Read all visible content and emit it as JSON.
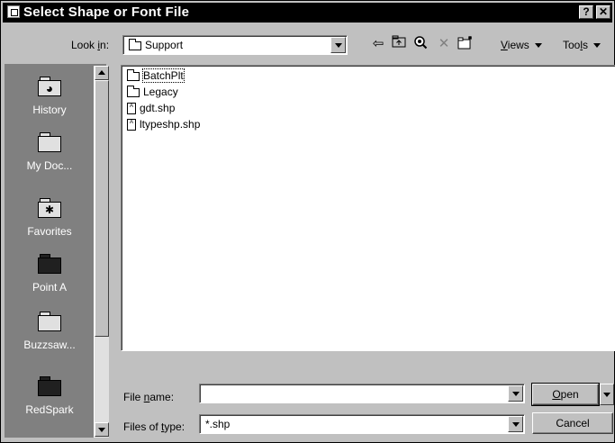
{
  "window": {
    "title": "Select Shape or Font File",
    "help_label": "?",
    "close_label": "✕"
  },
  "lookin": {
    "label": "Look in:",
    "label_hotkey": "i",
    "value": "Support"
  },
  "toolbar": {
    "back_icon": "back-arrow-icon",
    "up_icon": "up-folder-icon",
    "search_icon": "search-web-icon",
    "delete_icon": "delete-icon",
    "new_folder_icon": "new-folder-icon",
    "views_label": "Views",
    "tools_label": "Tools"
  },
  "places": [
    {
      "label": "History",
      "icon": "history-icon"
    },
    {
      "label": "My Doc...",
      "icon": "my-documents-icon"
    },
    {
      "label": "Favorites",
      "icon": "favorites-icon"
    },
    {
      "label": "Point A",
      "icon": "point-a-icon"
    },
    {
      "label": "Buzzsaw...",
      "icon": "buzzsaw-icon"
    },
    {
      "label": "RedSpark",
      "icon": "redspark-icon"
    }
  ],
  "files": [
    {
      "name": "BatchPlt",
      "type": "folder"
    },
    {
      "name": "Legacy",
      "type": "folder"
    },
    {
      "name": "gdt.shp",
      "type": "shp"
    },
    {
      "name": "ltypeshp.shp",
      "type": "shp"
    }
  ],
  "filename": {
    "label": "File name:",
    "value": ""
  },
  "filetype": {
    "label": "Files of type:",
    "value": "*.shp"
  },
  "buttons": {
    "open": "Open",
    "cancel": "Cancel"
  }
}
